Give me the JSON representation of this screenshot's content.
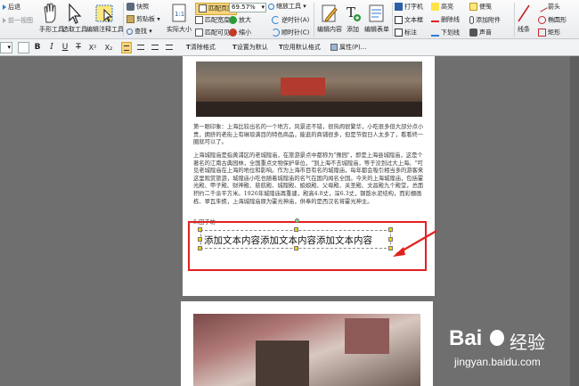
{
  "toolbar": {
    "col1": [
      "后退",
      "前一视图"
    ],
    "tools": [
      "手形工具",
      "选取工具",
      "编辑注释工具"
    ],
    "col_snap": [
      "快照",
      "剪贴板",
      "查找"
    ],
    "actual_size": "实际大小",
    "page_fit": [
      "匹配页面",
      "匹配宽度",
      "匹配可见"
    ],
    "zoom_value": "69.57%",
    "zoom_col": [
      "缩放工具",
      "放大",
      "缩小"
    ],
    "rotate": [
      "逆时针(A)",
      "顺时针(C)"
    ],
    "insert": [
      "编辑内容",
      "添加",
      "编辑表单"
    ],
    "comment_col1": [
      "打字机",
      "文本框",
      "标注"
    ],
    "comment_col2": [
      "高亮",
      "删除线",
      "下划线"
    ],
    "comment_col3": [
      "便笺",
      "添加附件",
      "声音"
    ],
    "draw_col": [
      "线条"
    ],
    "shapes": [
      "箭头",
      "椭圆形",
      "矩形"
    ]
  },
  "format_bar": {
    "buttons": [
      "B",
      "I",
      "U",
      "T",
      "X²",
      "X₂"
    ],
    "clear_format": "清除格式",
    "set_default": "设置为默认",
    "apply_default": "应用默认格式",
    "properties": "属性(P)..."
  },
  "document": {
    "para1": "第一眼印象：上海比较出名的一个地方，风景还不错，很热闹很繁华，小吃很多但大部分点小贵，拥挤的老街上有琳琅满目的特色商品，能逛的商铺很多，但是节假日人太多了，看看终一圈就可以了。",
    "para2": "上海城隍庙是指黄浦区的老城隍庙，在旅游景点中都称为\"豫园\"，即是上海县城隍庙，这是个著名的江南古典园林，全国重点文物保护单位，\"到上海不去城隍庙，等于没到过大上海。\"可见老城隍庙在上海的地位和影响。作为上海市目有名的城隍庙，每年都会吸引相当多的游客来这里观赏旅游，城隍庙小吃也随着城隍庙的名气在国内闻名全国。今天的上海城隍庙，包括霍光殿、甲子殿、财神殿、慈航殿、城隍殿、娘娘殿、父母殿、关圣殿、文昌殿九个殿堂，总面积约二千余平方米。1926年城隍庙再重建，殿高4.8丈，深6.3丈，钢筋水泥结构，而彩棚画栋、翠瓦朱檐，上海城隍庙原为霍光神庙，供奉的是西汉名将霍光神主。",
    "heading": "5.田子坊",
    "added_text": "添加文本内容添加文本内容添加文本内容"
  },
  "watermark": {
    "brand": "Bai",
    "brand_suffix": "经验",
    "url": "jingyan.baidu.com"
  }
}
